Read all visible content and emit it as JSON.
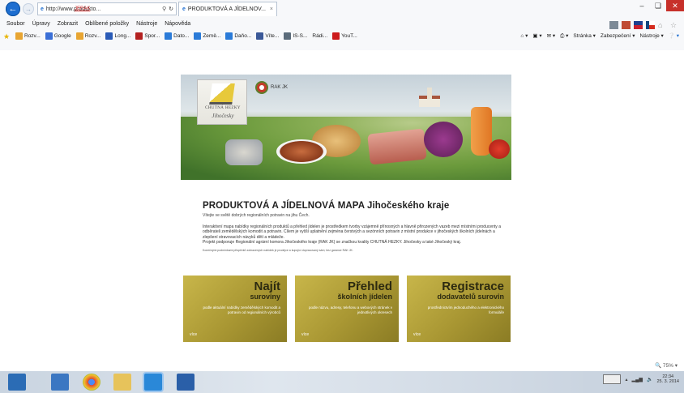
{
  "browser": {
    "address": "http://www.produkto...",
    "address_suffix": "ℛ ▾",
    "rak_link": "JERAK",
    "tab_title": "PRODUKTOVÁ A JÍDELNOV...",
    "tab_close": "×"
  },
  "menu": [
    "Soubor",
    "Úpravy",
    "Zobrazit",
    "Oblíbené položky",
    "Nástroje",
    "Nápověda"
  ],
  "favorites": [
    {
      "label": "Rozv...",
      "color": "#e8a532"
    },
    {
      "label": "Google",
      "color": "#3b6fd6"
    },
    {
      "label": "Rozv...",
      "color": "#e8a532"
    },
    {
      "label": "Long...",
      "color": "#2a5bb7"
    },
    {
      "label": "Spor...",
      "color": "#b32121"
    },
    {
      "label": "Dato...",
      "color": "#2b7bd8"
    },
    {
      "label": "Země...",
      "color": "#2b7bd8"
    },
    {
      "label": "Daňo...",
      "color": "#2b7bd8"
    },
    {
      "label": "Víte...",
      "color": "#3b5998"
    },
    {
      "label": "IS-S...",
      "color": "#5b6b7a"
    },
    {
      "label": "Rádi...",
      "color": "#ffffff"
    },
    {
      "label": "YouT...",
      "color": "#cc1b1b"
    }
  ],
  "commandbar": [
    "Stránka ▾",
    "Zabezpečení ▾",
    "Nástroje ▾"
  ],
  "banner": {
    "logo_line1": "CHUTNÁ HEZKY",
    "logo_line2": "Jihočesky",
    "rak_label": "RAK JK"
  },
  "intro": {
    "title": "PRODUKTOVÁ A JÍDELNOVÁ MAPA Jihočeského kraje",
    "subtitle": "Vítejte ve světě dobrých regionálních potravin na jihu Čech.",
    "paragraph1": "Interaktivní mapa nabídky regionálních produktů a přehled jídelen je prostředkem tvorby vzájemně přínosných a hlavně přirozených vazeb mezi místními producenty a odběrateli zemědělských komodit a potravin. Cílem je vyšší uplatnění zejména čerstvých a sezónních potravin z místní produkce v jihočeských školních jídelnách a zlepšení stravovacích návyků dětí a mládeže.",
    "paragraph2": "Projekt podporuje Regionální agrární komora Jihočeského kraje (RAK JK) se značkou kvality CHUTNÁ HEZKY. Jihočesky a také Jihočeský kraj.",
    "footnote": "Konečnými podmínkami příspěvků zobrazených nabídek je prodejce a kupující dopracovaný sám; bez garance RAK JK."
  },
  "cards": [
    {
      "title": "Najít",
      "subtitle": "suroviny",
      "desc": "podle aktuální nabídky zemědělských komodit a potravin od regionálních výrobců",
      "more": "více"
    },
    {
      "title": "Přehled",
      "subtitle": "školních jídelen",
      "desc": "podle názvu, adresy, telefonu a webových stránek v jednotlivých okresech",
      "more": "více"
    },
    {
      "title": "Registrace",
      "subtitle": "dodavatelů surovin",
      "desc": "prostřednictvím jednoduchého a elektronického formuláře",
      "more": "více"
    }
  ],
  "status": {
    "zoom": "75%"
  },
  "taskbar": {
    "apps": [
      {
        "name": "Server manager",
        "color": "#2b6cb5"
      },
      {
        "name": "Explorer",
        "color": "#3b77c2"
      },
      {
        "name": "Chrome",
        "color": "#e0472d"
      },
      {
        "name": "Folder",
        "color": "#e7c35b"
      },
      {
        "name": "Internet Explorer",
        "color": "#2a88d8"
      },
      {
        "name": "Word",
        "color": "#2a5fa8"
      }
    ],
    "time": "22:34",
    "date": "25. 3. 2014"
  }
}
